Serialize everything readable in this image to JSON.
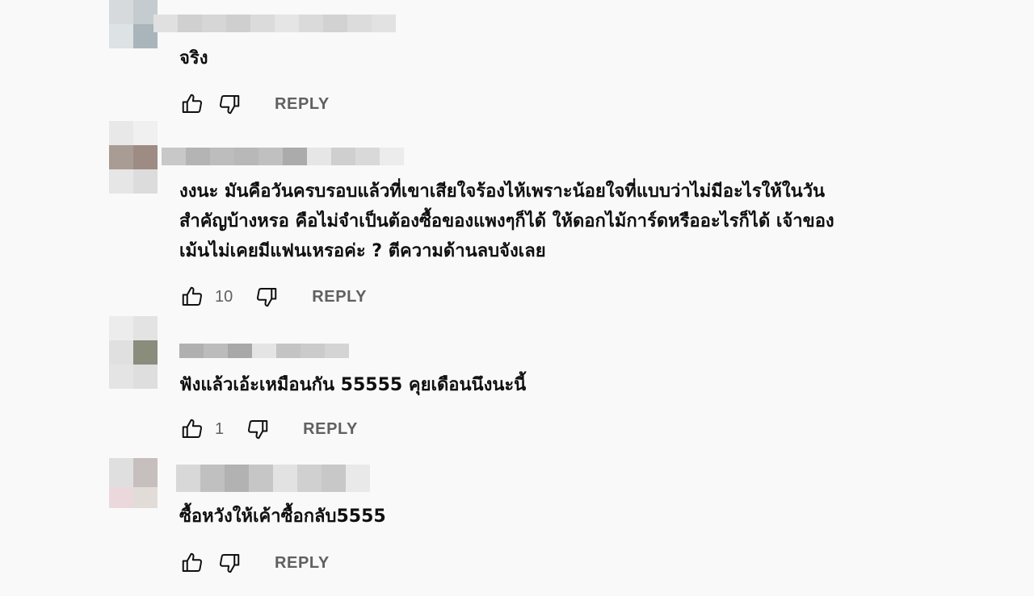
{
  "comments": [
    {
      "text": "จริง",
      "likes": "",
      "reply_label": "REPLY"
    },
    {
      "text": "งงนะ มันคือวันครบรอบแล้วที่เขาเสียใจร้องไห้เพราะน้อยใจที่แบบว่าไม่มีอะไรให้ในวัน\nสำคัญบ้างหรอ คือไม่จำเป็นต้องซื้อของแพงๆก็ได้ ให้ดอกไม้การ์ดหรืออะไรก็ได้ เจ้าของ\nเม้นไม่เคยมีแฟนเหรอค่ะ ? ตีความด้านลบจังเลย",
      "likes": "10",
      "reply_label": "REPLY"
    },
    {
      "text": "ฟังแล้วเอ้ะเหมือนกัน 55555 คุยเดือนนึงนะนี้",
      "likes": "1",
      "reply_label": "REPLY"
    },
    {
      "text": "ซื้อหวังให้เค้าซื้อกลับ5555",
      "likes": "",
      "reply_label": "REPLY"
    }
  ],
  "icons": {
    "like": "thumbs-up-icon",
    "dislike": "thumbs-down-icon"
  },
  "colors": {
    "background": "#f9f9f9",
    "text": "#0f0f0f",
    "secondary": "#606060"
  }
}
